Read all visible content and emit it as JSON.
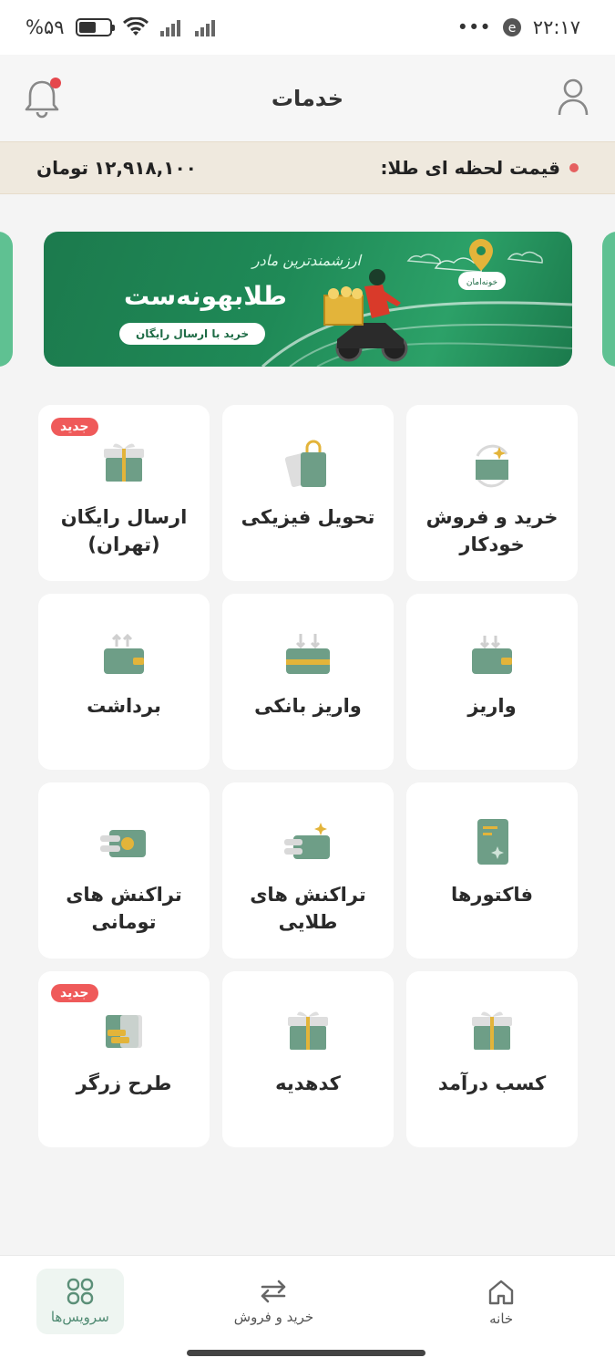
{
  "status_bar": {
    "time": "۲۲:۱۷",
    "battery": "%۵۹",
    "dots": "•••",
    "battery_level": 0.59
  },
  "header": {
    "title": "خدمات"
  },
  "price_bar": {
    "label": "قیمت لحظه ای طلا:",
    "value": "۱۲,۹۱۸,۱۰۰",
    "unit": "تومان"
  },
  "banner": {
    "tagline": "ارزشمندترین مادر",
    "headline": "طلابهونه‌ست",
    "cta": "خرید با ارسال رایگان",
    "location_tag": "خونه‌امان"
  },
  "services": [
    {
      "label": "خرید و فروش\nخودکار",
      "icon": "auto-trade-icon",
      "badge": ""
    },
    {
      "label": "تحویل فیزیکی",
      "icon": "shopping-bag-icon",
      "badge": ""
    },
    {
      "label": "ارسال رایگان\n(تهران)",
      "icon": "gift-box-icon",
      "badge": "جدید"
    },
    {
      "label": "واریز",
      "icon": "wallet-deposit-icon",
      "badge": ""
    },
    {
      "label": "واریز بانکی",
      "icon": "bank-deposit-icon",
      "badge": ""
    },
    {
      "label": "برداشت",
      "icon": "wallet-withdraw-icon",
      "badge": ""
    },
    {
      "label": "فاکتورها",
      "icon": "invoice-icon",
      "badge": ""
    },
    {
      "label": "تراکنش های\nطلایی",
      "icon": "gold-transactions-icon",
      "badge": ""
    },
    {
      "label": "تراکنش های\nتومانی",
      "icon": "toman-transactions-icon",
      "badge": ""
    },
    {
      "label": "کسب درآمد",
      "icon": "earn-income-icon",
      "badge": ""
    },
    {
      "label": "کدهدیه",
      "icon": "gift-code-icon",
      "badge": ""
    },
    {
      "label": "طرح زرگر",
      "icon": "goldsmith-plan-icon",
      "badge": "جدید"
    }
  ],
  "bottom_nav": {
    "home": "خانه",
    "trade": "خرید و فروش",
    "services": "سرویس‌ها"
  },
  "colors": {
    "accent_green": "#5b8f78",
    "gold": "#e3b43a",
    "badge_red": "#ef5a5a",
    "banner_green": "#1f8a57"
  }
}
